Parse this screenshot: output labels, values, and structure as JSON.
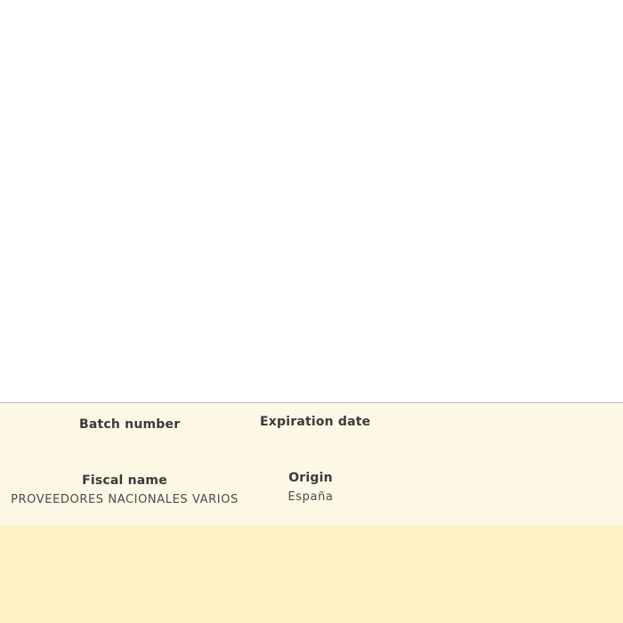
{
  "details": {
    "batch_number": {
      "label": "Batch number",
      "value": ""
    },
    "expiration_date": {
      "label": "Expiration date",
      "value": ""
    },
    "fiscal_name": {
      "label": "Fiscal name",
      "value": "PROVEEDORES NACIONALES VARIOS"
    },
    "origin": {
      "label": "Origin",
      "value": "España"
    }
  },
  "colors": {
    "panel_background": "#fdf8e6",
    "footer_background": "#fdf3c4",
    "divider": "#b9b6ad"
  }
}
